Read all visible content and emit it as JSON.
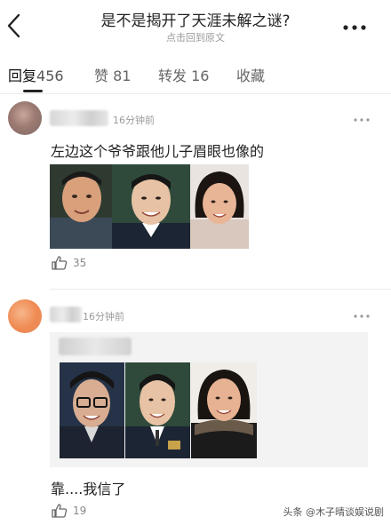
{
  "header": {
    "title": "是不是揭开了天涯未解之谜?",
    "subtitle": "点击回到原文"
  },
  "tabs": [
    {
      "label": "回复",
      "count": "456"
    },
    {
      "label": "赞",
      "count": "81"
    },
    {
      "label": "转发",
      "count": "16"
    },
    {
      "label": "收藏",
      "count": ""
    }
  ],
  "comments": [
    {
      "time": "16分钟前",
      "text": "左边这个爷爷跟他儿子眉眼也像的",
      "likes": "35"
    },
    {
      "time": "16分钟前",
      "text": "靠....我信了",
      "likes": "19"
    }
  ],
  "watermark": "头条 @木子晴谈娱说剧"
}
